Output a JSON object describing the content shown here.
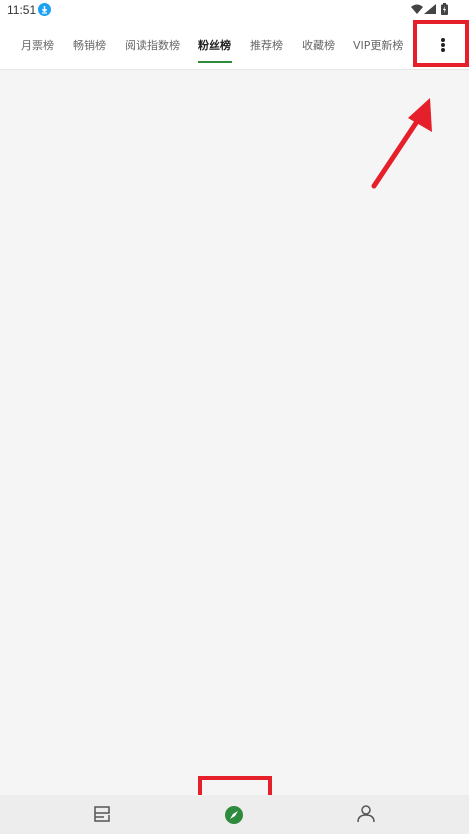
{
  "status_bar": {
    "time": "11:51"
  },
  "tabs": [
    {
      "label": "月票榜",
      "active": false
    },
    {
      "label": "畅销榜",
      "active": false
    },
    {
      "label": "阅读指数榜",
      "active": false
    },
    {
      "label": "粉丝榜",
      "active": true
    },
    {
      "label": "推荐榜",
      "active": false
    },
    {
      "label": "收藏榜",
      "active": false
    },
    {
      "label": "VIP更新榜",
      "active": false
    }
  ],
  "icons": {
    "more": "more-vertical-icon",
    "bookshelf": "bookshelf-icon",
    "discover": "compass-icon",
    "profile": "person-icon"
  },
  "colors": {
    "accent": "#2e8b3d",
    "annotation": "#e5202a",
    "background": "#f5f5f5"
  }
}
